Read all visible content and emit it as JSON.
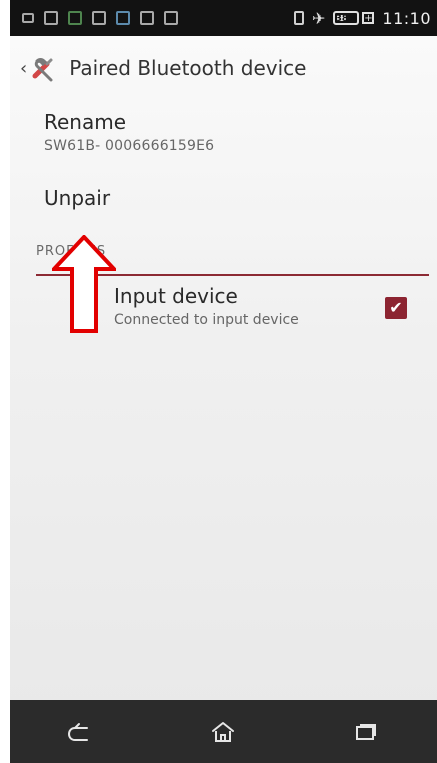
{
  "statusbar": {
    "time": "11:10",
    "battery_percent": "38%"
  },
  "appbar": {
    "title": "Paired Bluetooth device"
  },
  "items": {
    "rename": {
      "title": "Rename",
      "subtitle": "SW61B- 0006666159E6"
    },
    "unpair": {
      "title": "Unpair"
    },
    "profiles": {
      "header": "PROFILES"
    },
    "input_device": {
      "title": "Input device",
      "subtitle": "Connected to input device",
      "checked": true
    }
  },
  "colors": {
    "accent": "#8c2431",
    "divider": "#8c2a34",
    "annotation_red": "#e20000",
    "statusbar_bg": "#121212",
    "navbar_bg": "#2b2b2b"
  },
  "icons": {
    "back": "chevron-left-icon",
    "settings_tools": "tools-icon",
    "nav_back": "back-icon",
    "nav_home": "home-icon",
    "nav_recents": "recents-icon"
  }
}
